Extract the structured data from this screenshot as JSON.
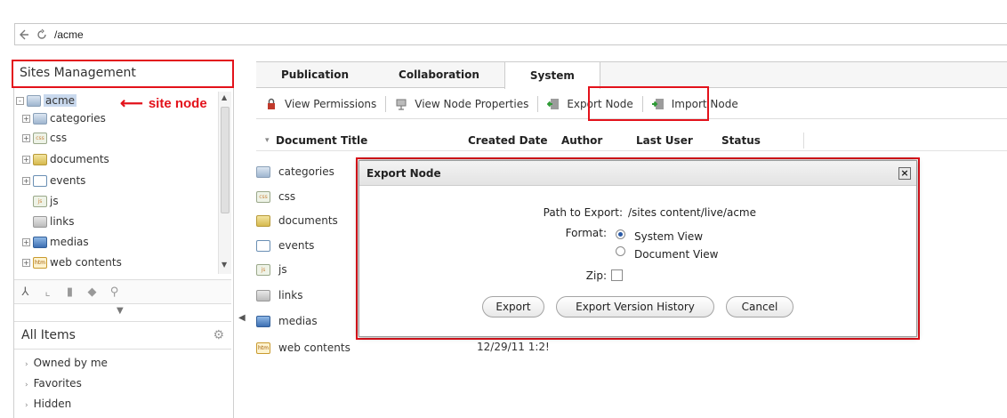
{
  "address_bar": {
    "path": "/acme"
  },
  "left_panel": {
    "title": "Sites Management",
    "tree": [
      {
        "label": "acme",
        "icon": "folder-icon",
        "expander": "-"
      },
      {
        "label": "categories",
        "icon": "folder-icon",
        "expander": "+"
      },
      {
        "label": "css",
        "icon": "css-file-icon",
        "expander": "+"
      },
      {
        "label": "documents",
        "icon": "documents-icon",
        "expander": "+"
      },
      {
        "label": "events",
        "icon": "events-icon",
        "expander": "+"
      },
      {
        "label": "js",
        "icon": "js-file-icon",
        "expander": ""
      },
      {
        "label": "links",
        "icon": "links-icon",
        "expander": ""
      },
      {
        "label": "medias",
        "icon": "medias-icon",
        "expander": "+"
      },
      {
        "label": "web contents",
        "icon": "web-contents-icon",
        "expander": "+"
      }
    ],
    "annotation": "site node",
    "all_items": {
      "title": "All Items",
      "filters": [
        "Owned by me",
        "Favorites",
        "Hidden"
      ]
    }
  },
  "tabs": [
    "Publication",
    "Collaboration",
    "System"
  ],
  "active_tab": "System",
  "toolbar": {
    "view_permissions": "View Permissions",
    "view_node_properties": "View Node Properties",
    "export_node": "Export Node",
    "import_node": "Import Node"
  },
  "columns": {
    "document_title": "Document Title",
    "created_date": "Created Date",
    "author": "Author",
    "last_user": "Last User",
    "status": "Status"
  },
  "files": [
    {
      "name": "categories",
      "icon": "folder-icon",
      "created": ""
    },
    {
      "name": "css",
      "icon": "css-file-icon",
      "created": ""
    },
    {
      "name": "documents",
      "icon": "documents-icon",
      "created": ""
    },
    {
      "name": "events",
      "icon": "events-icon",
      "created": ""
    },
    {
      "name": "js",
      "icon": "js-file-icon",
      "created": ""
    },
    {
      "name": "links",
      "icon": "links-icon",
      "created": ""
    },
    {
      "name": "medias",
      "icon": "medias-icon",
      "created": ""
    },
    {
      "name": "web contents",
      "icon": "web-contents-icon",
      "created": "12/29/11 1:2!"
    }
  ],
  "dialog": {
    "title": "Export Node",
    "path_label": "Path to Export:",
    "path_value": "/sites content/live/acme",
    "format_label": "Format:",
    "format_options": [
      "System View",
      "Document View"
    ],
    "format_selected": "System View",
    "zip_label": "Zip:",
    "zip_checked": false,
    "buttons": {
      "export": "Export",
      "export_version_history": "Export Version History",
      "cancel": "Cancel"
    }
  },
  "colors": {
    "highlight_red": "#e3121b",
    "selection_blue": "#c9d9ee"
  }
}
